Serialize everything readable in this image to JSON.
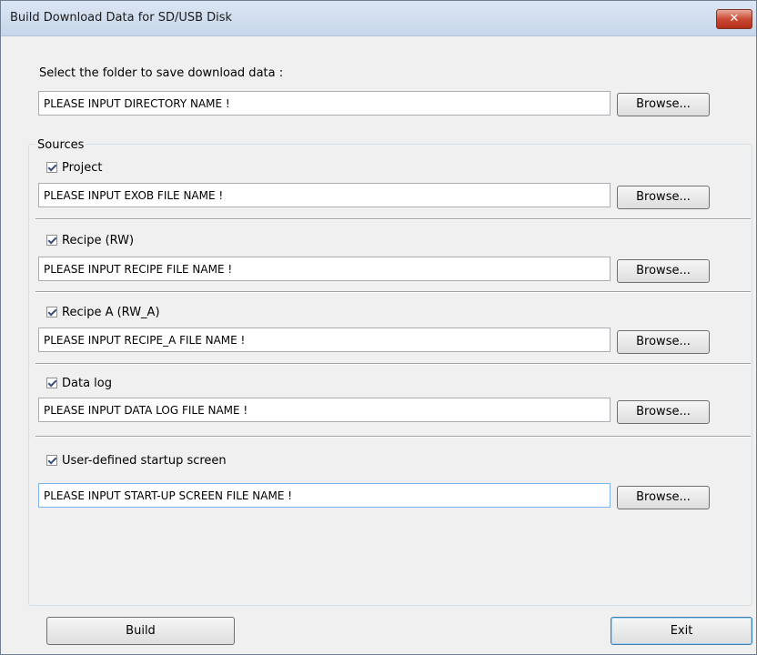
{
  "window": {
    "title": "Build Download Data for SD/USB Disk",
    "close_label": "✕"
  },
  "folder": {
    "prompt": "Select the folder to save download data :",
    "value": "PLEASE INPUT DIRECTORY NAME !",
    "browse_label": "Browse..."
  },
  "sources": {
    "legend": "Sources",
    "items": [
      {
        "label": "Project",
        "checked": true,
        "value": "PLEASE INPUT EXOB FILE NAME !",
        "browse_label": "Browse..."
      },
      {
        "label": "Recipe (RW)",
        "checked": true,
        "value": "PLEASE INPUT RECIPE FILE NAME !",
        "browse_label": "Browse..."
      },
      {
        "label": "Recipe A (RW_A)",
        "checked": true,
        "value": "PLEASE INPUT RECIPE_A FILE NAME !",
        "browse_label": "Browse..."
      },
      {
        "label": "Data log",
        "checked": true,
        "value": "PLEASE INPUT DATA LOG FILE NAME !",
        "browse_label": "Browse..."
      },
      {
        "label": "User-defined startup screen",
        "checked": true,
        "value": "PLEASE INPUT START-UP SCREEN FILE NAME !",
        "browse_label": "Browse..."
      }
    ]
  },
  "footer": {
    "build_label": "Build",
    "exit_label": "Exit"
  },
  "colors": {
    "title_bar": "#c7d6ea",
    "close_button": "#c94a35",
    "dialog_bg": "#f0f0f0",
    "focus_border": "#7eb4ea"
  }
}
